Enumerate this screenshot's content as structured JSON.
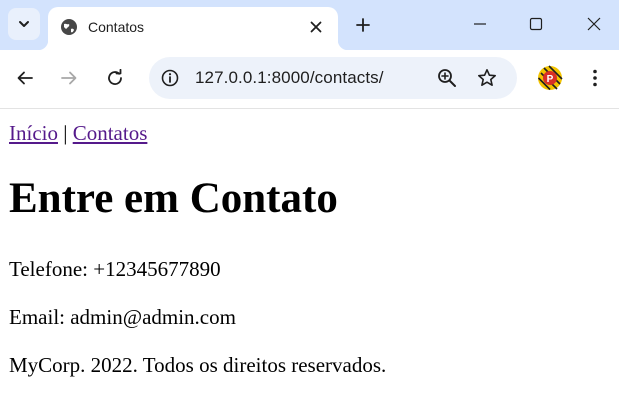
{
  "browser": {
    "tab": {
      "title": "Contatos"
    },
    "address_bar": {
      "url": "127.0.0.1:8000/contacts/"
    }
  },
  "page": {
    "nav": {
      "home_link": "Início",
      "separator": "|",
      "contacts_link": "Contatos"
    },
    "heading": "Entre em Contato",
    "phone": "Telefone: +12345677890",
    "email": "Email: admin@admin.com",
    "footer": "MyCorp. 2022. Todos os direitos reservados."
  },
  "colors": {
    "tabstrip_bg": "#d3e3fd",
    "omnibox_bg": "#edf2fa",
    "visited_link": "#551a8b"
  },
  "icons": {
    "tab_search": "chevron-down-icon",
    "favicon": "globe-icon",
    "tab_close": "close-icon",
    "new_tab": "plus-icon",
    "minimize": "minimize-icon",
    "maximize": "maximize-icon",
    "window_close": "close-icon",
    "back": "arrow-left-icon",
    "forward": "arrow-right-icon",
    "reload": "reload-icon",
    "site_info": "info-icon",
    "zoom": "zoom-in-icon",
    "bookmark": "star-icon",
    "profile": "profile-avatar-icon",
    "menu": "kebab-menu-icon"
  }
}
